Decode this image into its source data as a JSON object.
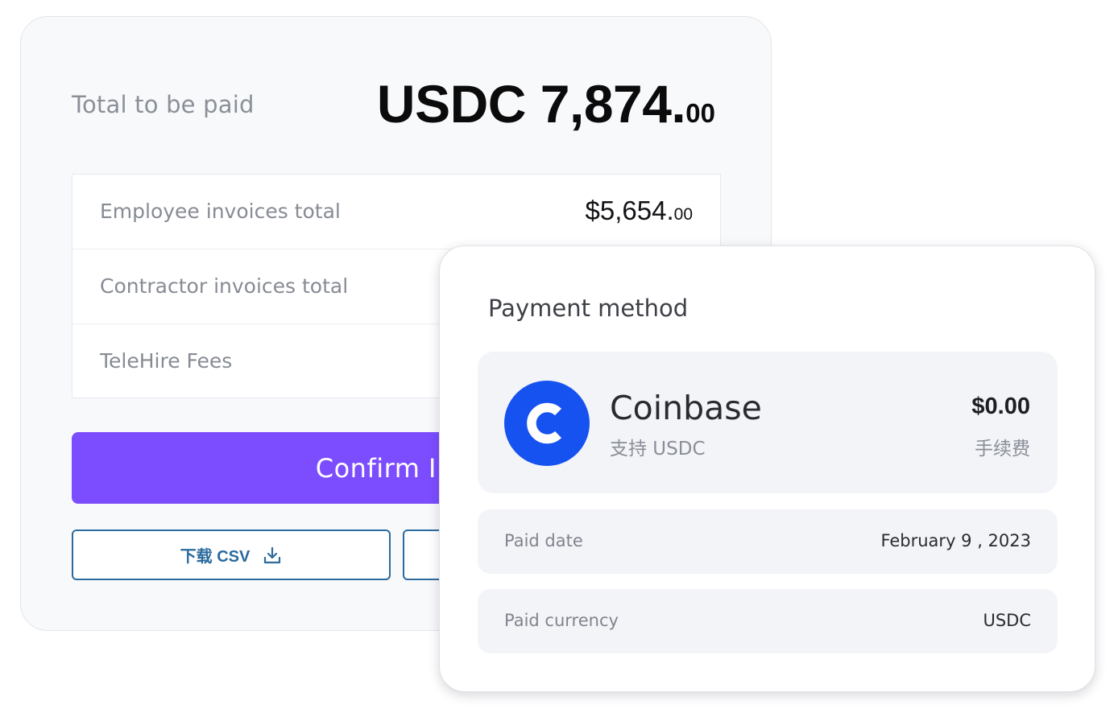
{
  "summary": {
    "total_label": "Total to be paid",
    "total_amount_main": "USDC 7,874.",
    "total_amount_cents": "00",
    "rows": [
      {
        "label": "Employee invoices total",
        "value_main": "$5,654.",
        "value_cents": "00"
      },
      {
        "label": "Contractor invoices total"
      },
      {
        "label": "TeleHire Fees"
      }
    ],
    "confirm_label": "Confirm I’ve",
    "download_label": "下载 CSV",
    "download_icon": "download-icon"
  },
  "payment": {
    "title": "Payment method",
    "provider": {
      "name": "Coinbase",
      "subtitle": "支持 USDC",
      "fee": "$0.00",
      "fee_label": "手续费",
      "logo_icon": "coinbase-logo-icon"
    },
    "details": [
      {
        "label": "Paid date",
        "value": "February 9 , 2023"
      },
      {
        "label": "Paid currency",
        "value": "USDC"
      }
    ]
  },
  "colors": {
    "accent": "#7b4dff",
    "coinbase_blue": "#1652f0",
    "outline_button": "#2b6a9c"
  }
}
